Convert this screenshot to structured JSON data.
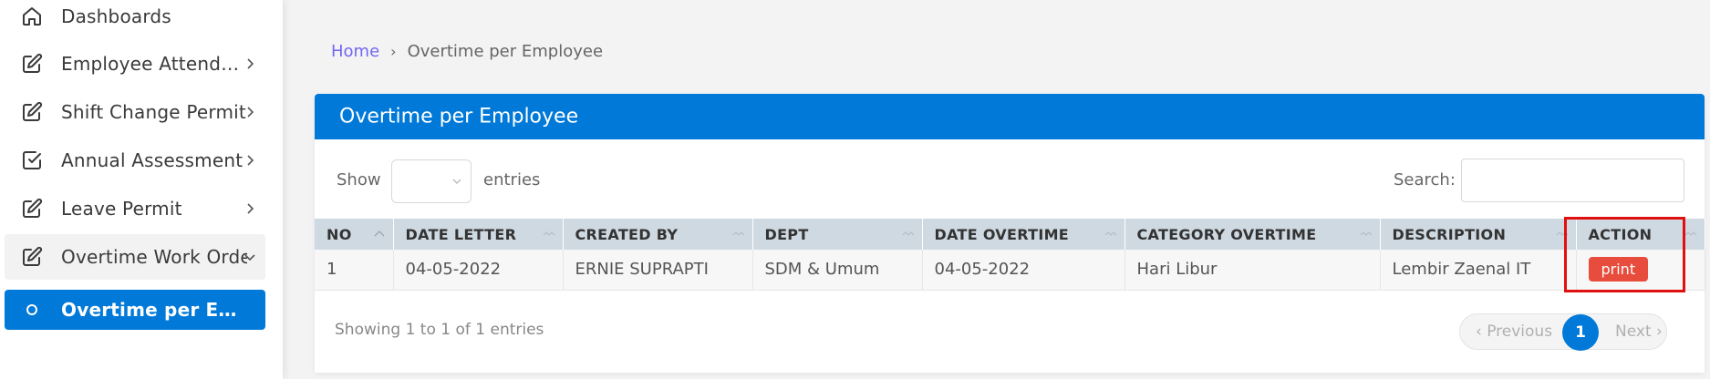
{
  "sidebar": {
    "items": [
      {
        "label": "Dashboards",
        "icon": "home-icon"
      },
      {
        "label": "Employee Attendance",
        "icon": "edit-icon"
      },
      {
        "label": "Shift Change Permit",
        "icon": "edit-icon"
      },
      {
        "label": "Annual Assessment",
        "icon": "check-square-icon"
      },
      {
        "label": "Leave Permit",
        "icon": "edit-icon"
      },
      {
        "label": "Overtime Work Order",
        "icon": "edit-icon"
      },
      {
        "label": "Overtime per Employee",
        "icon": "circle-icon"
      }
    ]
  },
  "breadcrumb": {
    "home": "Home",
    "separator": "›",
    "current": "Overtime per Employee"
  },
  "card": {
    "title": "Overtime per Employee"
  },
  "controls": {
    "show": "Show",
    "entries": "entries",
    "search": "Search:"
  },
  "table": {
    "headers": [
      "NO",
      "DATE LETTER",
      "CREATED BY",
      "DEPT",
      "DATE OVERTIME",
      "CATEGORY OVERTIME",
      "DESCRIPTION",
      "ACTION"
    ],
    "rows": [
      {
        "no": "1",
        "date_letter": "04-05-2022",
        "created_by": "ERNIE SUPRAPTI",
        "dept": "SDM & Umum",
        "date_overtime": "04-05-2022",
        "category": "Hari Libur",
        "description": "Lembir Zaenal IT",
        "action": "print"
      }
    ]
  },
  "footer": {
    "showing": "Showing 1 to 1 of 1 entries"
  },
  "pagination": {
    "previous": "‹ Previous",
    "current": "1",
    "next": "Next ›"
  },
  "colors": {
    "primary": "#0079d8",
    "danger": "#e74c3c",
    "link": "#7367f0",
    "highlight": "#e01010"
  }
}
